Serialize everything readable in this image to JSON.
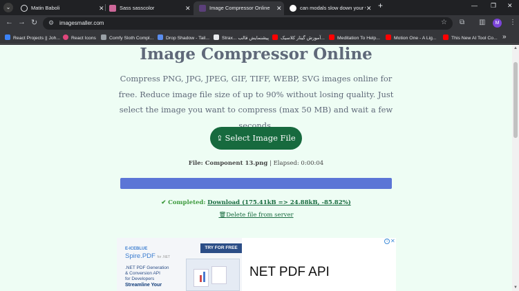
{
  "browser": {
    "tabs": [
      {
        "title": "Matin Baboli",
        "favicon_color": "#202124",
        "active": false
      },
      {
        "title": "Sass sasscolor",
        "favicon_color": "#cd6799",
        "active": false
      },
      {
        "title": "Image Compressor Online, Red",
        "favicon_color": "#5b3f7a",
        "active": true
      },
      {
        "title": "can modals slow down your we",
        "favicon_color": "#ffffff",
        "active": false
      }
    ],
    "new_tab": "+",
    "url": "imagesmaller.com",
    "profile_initial": "M",
    "bookmarks": [
      {
        "label": "React Projects || Joh...",
        "icon_color": "#3b82f6"
      },
      {
        "label": "React Icons",
        "icon_color": "#e0467c"
      },
      {
        "label": "Comfy Sloth Compl...",
        "icon_color": "#9aa0a6"
      },
      {
        "label": "Drop Shadow - Tail...",
        "icon_color": "#5a8dee"
      },
      {
        "label": "Strax... پیشنمایش قالب",
        "icon_color": "#e8eaed"
      },
      {
        "label": "آموزش گیتار کلاسیک...",
        "icon_color": "#ff0000"
      },
      {
        "label": "Meditation To Help...",
        "icon_color": "#ff0000"
      },
      {
        "label": "Motion One - A Lig...",
        "icon_color": "#ff0000"
      },
      {
        "label": "This New AI Tool Co...",
        "icon_color": "#ff0000"
      }
    ]
  },
  "page": {
    "title": "Image Compressor Online",
    "description": "Compress PNG, JPG, JPEG, GIF, TIFF, WEBP, SVG images online for free. Reduce image file size of up to 90% without losing quality. Just select the image you want to compress (max 50 MB) and wait a few seconds.",
    "select_button": "Select Image File",
    "file_label": "File: Component 13.png",
    "elapsed": "| Elapsed: 0:00:04",
    "progress_fraction": 1.0,
    "completed_label": "Completed:",
    "download_link": "Download (175.41kB => 24.88kB, -85.82%)",
    "delete_link": "Delete file from server"
  },
  "ad": {
    "brand": "E-ICEBLUE",
    "product": "Spire.PDF",
    "product_suffix": "for .NET",
    "try_label": "TRY FOR FREE",
    "line1": ".NET PDF Generation",
    "line2": "& Conversion API",
    "line3": "for Developers",
    "line4": "Streamline Your",
    "headline": "NET PDF API"
  },
  "colors": {
    "page_bg": "#eefdf4",
    "button_green": "#176a3e",
    "progress_blue": "#5b75d6",
    "completed_green": "#3d9a3d"
  }
}
